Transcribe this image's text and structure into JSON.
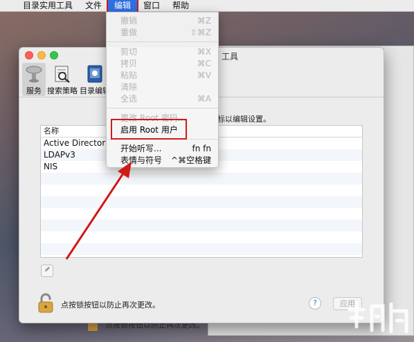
{
  "menubar": {
    "apple": "",
    "items": [
      {
        "label": "目录实用工具"
      },
      {
        "label": "文件"
      },
      {
        "label": "编辑"
      },
      {
        "label": "窗口"
      },
      {
        "label": "帮助"
      }
    ]
  },
  "window": {
    "title": "工具",
    "toolbar": [
      {
        "label": "服务",
        "icon": "services-icon"
      },
      {
        "label": "搜索策略",
        "icon": "search-policy-icon"
      },
      {
        "label": "目录编辑",
        "icon": "directory-editor-icon"
      }
    ],
    "description": "标以编辑设置。",
    "table": {
      "header": "名称",
      "rows": [
        "Active Directory",
        "LDAPv3",
        "NIS"
      ]
    },
    "lock_text": "点按锁按钮以防止再次更改。",
    "help_label": "?",
    "apply_label": "应用"
  },
  "background_window": {
    "lock_text": "点按锁按钮以防止再次更改。"
  },
  "edit_menu": {
    "items": [
      {
        "label": "撤销",
        "shortcut": "⌘Z",
        "disabled": true
      },
      {
        "label": "重做",
        "shortcut": "⇧⌘Z",
        "disabled": true
      },
      {
        "label": "剪切",
        "shortcut": "⌘X",
        "disabled": true
      },
      {
        "label": "拷贝",
        "shortcut": "⌘C",
        "disabled": true
      },
      {
        "label": "粘贴",
        "shortcut": "⌘V",
        "disabled": true
      },
      {
        "label": "清除",
        "shortcut": "",
        "disabled": true
      },
      {
        "label": "全选",
        "shortcut": "⌘A",
        "disabled": true
      },
      {
        "label": "更改 Root 密码...",
        "shortcut": "",
        "disabled": true
      },
      {
        "label": "启用 Root 用户",
        "shortcut": "",
        "disabled": false
      },
      {
        "label": "开始听写...",
        "shortcut": "fn fn",
        "disabled": false
      },
      {
        "label": "表情与符号",
        "shortcut": "^⌘空格键",
        "disabled": false
      }
    ]
  },
  "colors": {
    "highlight_red": "#d01919",
    "menu_active_blue": "#2f6fe0"
  }
}
